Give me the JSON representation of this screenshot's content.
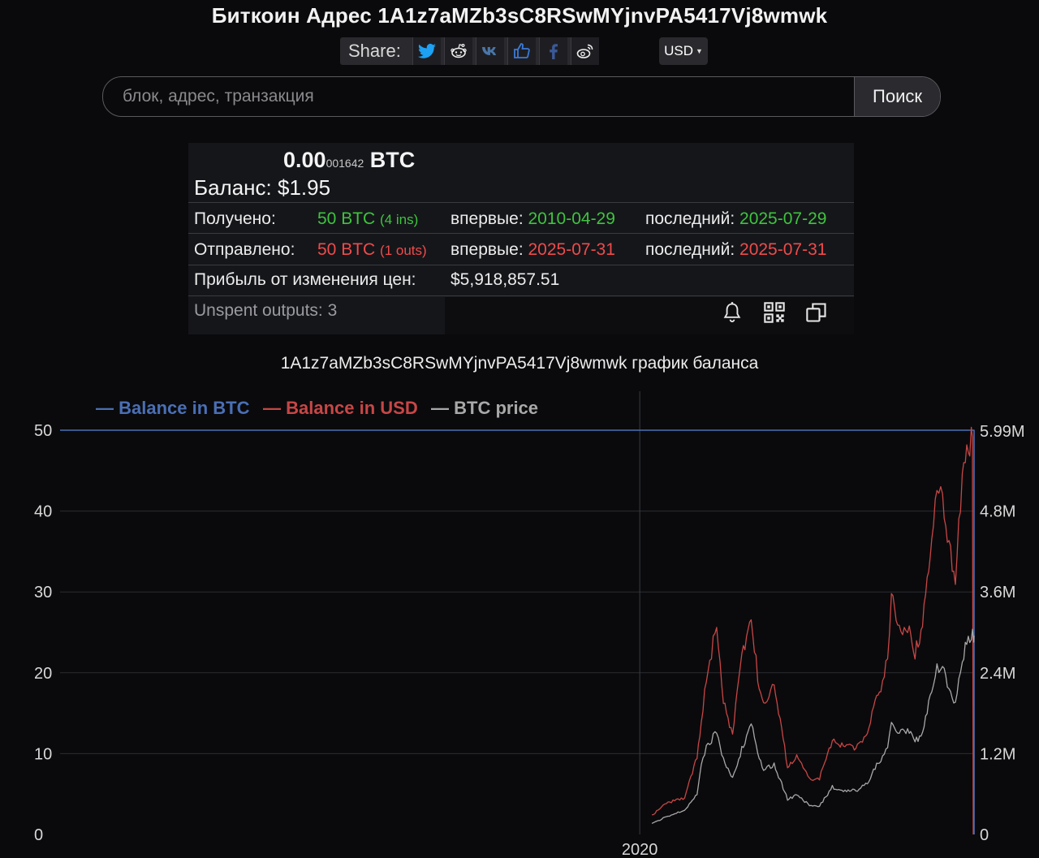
{
  "header": {
    "title": "Биткоин Адрес 1A1z7aMZb3sC8RSwMYjnvPA5417Vj8wmwk"
  },
  "share": {
    "label": "Share:",
    "buttons": [
      {
        "name": "twitter-icon",
        "color": "#1da1f2"
      },
      {
        "name": "reddit-icon",
        "color": "#ffffff"
      },
      {
        "name": "vk-icon",
        "color": "#4a76a8"
      },
      {
        "name": "like-icon",
        "color": "#3b7ad8"
      },
      {
        "name": "facebook-icon",
        "color": "#3b5998"
      },
      {
        "name": "weibo-icon",
        "color": "#ffffff"
      }
    ]
  },
  "currency": {
    "selected": "USD"
  },
  "search": {
    "placeholder": "блок, адрес, транзакция",
    "button_label": "Поиск"
  },
  "summary": {
    "btc_main": "0.00",
    "btc_small": "001642",
    "btc_unit": "BTC",
    "balance_label": "Баланс:",
    "balance_value": "$1.95",
    "received_label": "Получено:",
    "received_amount": "50 BTC",
    "received_count": "(4 ins)",
    "sent_label": "Отправлено:",
    "sent_amount": "50 BTC",
    "sent_count": "(1 outs)",
    "first_label": "впервые:",
    "last_label": "последний:",
    "received_first": "2010-04-29",
    "received_last": "2025-07-29",
    "sent_first": "2025-07-31",
    "sent_last": "2025-07-31",
    "profit_label": "Прибыль от изменения цен:",
    "profit_value": "$5,918,857.51",
    "unspent": "Unspent outputs: 3",
    "tools": [
      "bell-icon",
      "qr-code-icon",
      "copy-icon"
    ]
  },
  "chart_title": "1A1z7aMZb3sC8RSwMYjnvPA5417Vj8wmwk график баланса",
  "chart_data": {
    "type": "line",
    "title": "1A1z7aMZb3sC8RSwMYjnvPA5417Vj8wmwk график баланса",
    "legend": [
      "— Balance in BTC",
      "— Balance in USD",
      "— BTC price"
    ],
    "legend_placement": "top-left",
    "grid": true,
    "x_ticks": [
      "2020"
    ],
    "y_left": {
      "ticks": [
        "0",
        "10",
        "20",
        "30",
        "40",
        "50"
      ],
      "range": [
        0,
        50
      ]
    },
    "y_right": {
      "ticks": [
        "0",
        "1.2M",
        "2.4M",
        "3.6M",
        "4.8M",
        "5.99M"
      ],
      "range": [
        0,
        6000000
      ]
    },
    "colors": {
      "btc": "#4a6fb5",
      "usd": "#c84646",
      "price": "#a8a8a8"
    },
    "x_range": [
      "2010-04-29",
      "2025-07-31"
    ],
    "series": [
      {
        "name": "Balance in BTC",
        "axis": "left",
        "x": [
          "2010-04-29",
          "2025-07-29",
          "2025-07-31",
          "2025-07-31"
        ],
        "values": [
          50,
          50,
          50,
          1.642e-05
        ]
      },
      {
        "name": "Balance in USD",
        "axis": "right",
        "x": [
          "2020-03-15",
          "2020-06-01",
          "2020-10-01",
          "2020-12-15",
          "2021-01-10",
          "2021-02-20",
          "2021-04-14",
          "2021-05-25",
          "2021-07-20",
          "2021-09-05",
          "2021-11-10",
          "2021-12-20",
          "2022-01-25",
          "2022-03-30",
          "2022-05-15",
          "2022-06-20",
          "2022-08-15",
          "2022-11-10",
          "2023-01-01",
          "2023-03-20",
          "2023-06-15",
          "2023-08-20",
          "2023-10-20",
          "2023-12-15",
          "2024-01-10",
          "2024-02-20",
          "2024-03-14",
          "2024-05-01",
          "2024-07-01",
          "2024-08-05",
          "2024-09-20",
          "2024-11-15",
          "2024-12-17",
          "2025-01-20",
          "2025-03-10",
          "2025-04-08",
          "2025-05-20",
          "2025-07-14",
          "2025-07-29",
          "2025-07-31"
        ],
        "values": [
          280000,
          460000,
          540000,
          1150000,
          1700000,
          2450000,
          3100000,
          1950000,
          1500000,
          2500000,
          3200000,
          2350000,
          1900000,
          2300000,
          1550000,
          1000000,
          1150000,
          830000,
          830000,
          1400000,
          1300000,
          1300000,
          1500000,
          2100000,
          2150000,
          2600000,
          3570000,
          3000000,
          3100000,
          2700000,
          3100000,
          4300000,
          5100000,
          5000000,
          4150000,
          3800000,
          5300000,
          5900000,
          5850000,
          0
        ]
      },
      {
        "name": "BTC price",
        "axis": "right",
        "x": [
          "2020-03-15",
          "2020-06-01",
          "2020-10-01",
          "2020-12-15",
          "2021-01-10",
          "2021-02-20",
          "2021-04-14",
          "2021-05-25",
          "2021-07-20",
          "2021-09-05",
          "2021-11-10",
          "2021-12-20",
          "2022-01-25",
          "2022-03-30",
          "2022-05-15",
          "2022-06-20",
          "2022-08-15",
          "2022-11-10",
          "2023-01-01",
          "2023-03-20",
          "2023-06-15",
          "2023-08-20",
          "2023-10-20",
          "2023-12-15",
          "2024-01-10",
          "2024-02-20",
          "2024-03-14",
          "2024-05-01",
          "2024-07-01",
          "2024-08-05",
          "2024-09-20",
          "2024-11-15",
          "2024-12-17",
          "2025-01-20",
          "2025-03-10",
          "2025-04-08",
          "2025-05-20",
          "2025-07-14",
          "2025-07-29",
          "2025-07-31"
        ],
        "values": [
          160000,
          250000,
          360000,
          600000,
          1050000,
          1350000,
          1500000,
          1100000,
          850000,
          1200000,
          1650000,
          1180000,
          950000,
          1050000,
          750000,
          520000,
          580000,
          420000,
          420000,
          700000,
          650000,
          650000,
          760000,
          1050000,
          1100000,
          1300000,
          1700000,
          1500000,
          1550000,
          1350000,
          1550000,
          2150000,
          2480000,
          2450000,
          2080000,
          1900000,
          2650000,
          3000000,
          2950000,
          2950000
        ]
      }
    ]
  }
}
